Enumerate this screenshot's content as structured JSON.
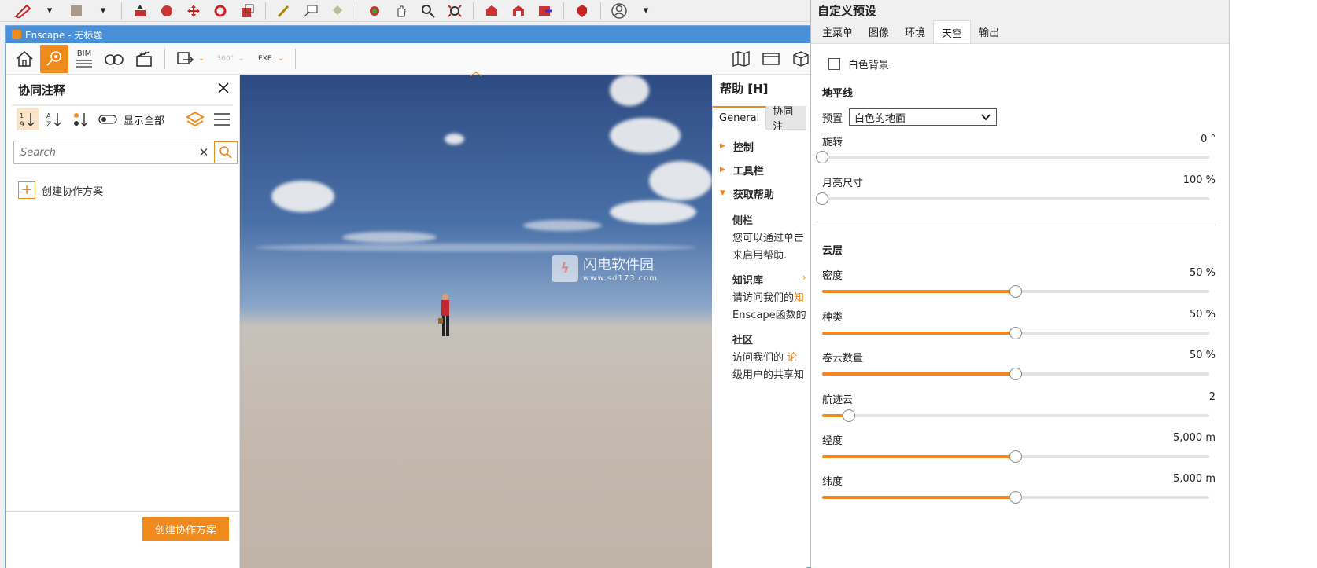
{
  "enscape": {
    "window_title": "Enscape - 无标题",
    "toolbar_bim": "BIM",
    "toolbar_360": "360°",
    "toolbar_exe": "EXE"
  },
  "left_panel": {
    "title": "协同注释",
    "show_all": "显示全部",
    "search_placeholder": "Search",
    "create_item": "创建协作方案",
    "footer_button": "创建协作方案"
  },
  "viewport": {
    "watermark_name": "闪电软件园",
    "watermark_url": "www.sd173.com"
  },
  "help": {
    "title": "帮助 [H]",
    "tabs": [
      "General",
      "协同注"
    ],
    "items": [
      "控制",
      "工具栏",
      "获取帮助"
    ],
    "sidebar_heading": "侧栏",
    "sidebar_text1": "您可以通过单击",
    "sidebar_text2": "来启用帮助.",
    "kb_heading": "知识库",
    "kb_text1": "请访问我们的",
    "kb_link1": "知",
    "kb_text2": "Enscape函数的",
    "community_heading": "社区",
    "community_text1": "访问我们的",
    "community_link": "论",
    "community_text2": "级用户的共享知"
  },
  "settings": {
    "title": "自定义预设",
    "tabs": [
      "主菜单",
      "图像",
      "环境",
      "天空",
      "输出"
    ],
    "active_tab": "天空",
    "white_bg_label": "白色背景",
    "horizon_heading": "地平线",
    "preset_label": "预置",
    "preset_value": "白色的地面",
    "rotation_label": "旋转",
    "rotation_value": "0 °",
    "moon_label": "月亮尺寸",
    "moon_value": "100 %",
    "clouds_heading": "云层",
    "density_label": "密度",
    "density_value": "50 %",
    "variety_label": "种类",
    "variety_value": "50 %",
    "cirrus_label": "卷云数量",
    "cirrus_value": "50 %",
    "contrails_label": "航迹云",
    "contrails_value": "2",
    "longitude_label": "经度",
    "longitude_value": "5,000 m",
    "latitude_label": "纬度",
    "latitude_value": "5,000 m",
    "sliders": {
      "rotation": 0.0,
      "moon": 0.0,
      "density": 0.5,
      "variety": 0.5,
      "cirrus": 0.5,
      "contrails": 0.07,
      "longitude": 0.5,
      "latitude": 0.5
    }
  },
  "colors": {
    "accent": "#f08a1c",
    "titlebar": "#4a90d9"
  }
}
